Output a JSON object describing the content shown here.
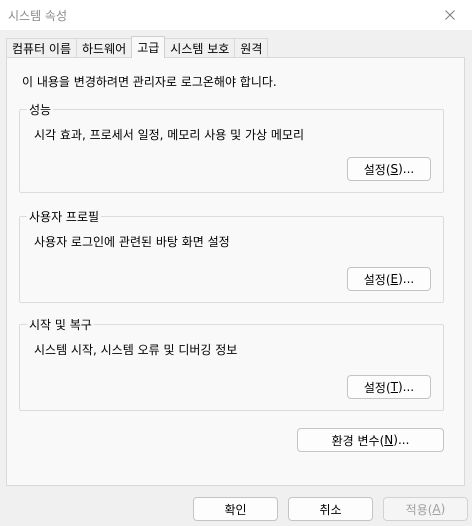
{
  "window": {
    "title": "시스템 속성"
  },
  "tabs": [
    {
      "label": "컴퓨터 이름",
      "active": false
    },
    {
      "label": "하드웨어",
      "active": false
    },
    {
      "label": "고급",
      "active": true
    },
    {
      "label": "시스템 보호",
      "active": false
    },
    {
      "label": "원격",
      "active": false
    }
  ],
  "notice": "이 내용을 변경하려면 관리자로 로그온해야 합니다.",
  "groups": {
    "performance": {
      "title": "성능",
      "description": "시각 효과, 프로세서 일정, 메모리 사용 및 가상 메모리",
      "button": {
        "prefix": "설정(",
        "mnemonic": "S",
        "suffix": ")..."
      }
    },
    "user_profile": {
      "title": "사용자 프로필",
      "description": "사용자 로그인에 관련된 바탕 화면 설정",
      "button": {
        "prefix": "설정(",
        "mnemonic": "E",
        "suffix": ")..."
      }
    },
    "startup_recovery": {
      "title": "시작 및 복구",
      "description": "시스템 시작, 시스템 오류 및 디버깅 정보",
      "button": {
        "prefix": "설정(",
        "mnemonic": "T",
        "suffix": ")..."
      }
    }
  },
  "env_button": {
    "prefix": "환경 변수(",
    "mnemonic": "N",
    "suffix": ")..."
  },
  "footer": {
    "ok": "확인",
    "cancel": "취소",
    "apply": {
      "prefix": "적용(",
      "mnemonic": "A",
      "suffix": ")"
    }
  },
  "icons": {
    "close": "close-icon"
  },
  "colors": {
    "window_bg": "#f0f0f0",
    "panel_bg": "#f9f9f9",
    "disabled_text": "#a0a0a0"
  }
}
